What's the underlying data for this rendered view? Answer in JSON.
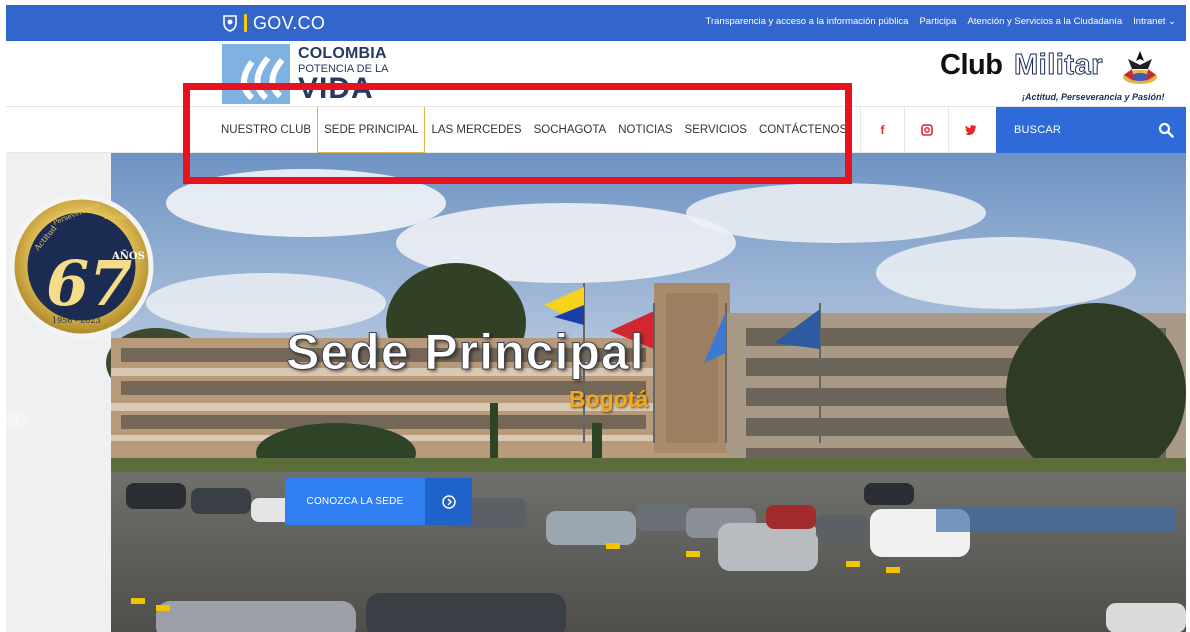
{
  "gov_bar": {
    "logo_text": "GOV.CO",
    "links": [
      "Transparencia y acceso a la información pública",
      "Participa",
      "Atención y Servicios a la Ciudadanía",
      "Intranet ⌄"
    ],
    "color": "#3366cc"
  },
  "header": {
    "colombia_logo": {
      "line1": "COLOMBIA",
      "line2": "POTENCIA DE LA",
      "line3": "VIDA"
    },
    "club_logo": {
      "club": "Club",
      "militar": "Militar",
      "tagline": "¡Actitud, Perseverancia y Pasión!"
    }
  },
  "nav": {
    "items": [
      "NUESTRO CLUB",
      "SEDE PRINCIPAL",
      "LAS MERCEDES",
      "SOCHAGOTA",
      "NOTICIAS",
      "SERVICIOS",
      "CONTÁCTENOS"
    ],
    "active": "SEDE PRINCIPAL",
    "social": [
      {
        "name": "facebook-icon",
        "glyph": "f"
      },
      {
        "name": "instagram-icon",
        "glyph": "◙"
      },
      {
        "name": "twitter-icon",
        "glyph": "🐦"
      }
    ],
    "search_label": "BUSCAR",
    "search_color": "#2f6bd8"
  },
  "hero": {
    "title": "Sede Principal",
    "subtitle": "Bogotá",
    "cta_label": "CONOZCA LA SEDE",
    "cta_color": "#2f7ff0",
    "subtitle_color": "#f4a81c"
  },
  "badge": {
    "number": "67",
    "years": "AÑOS",
    "words": "Actitud Perseverancia Pasión",
    "range": "1956 - 2023"
  },
  "annotation": {
    "color": "#e8121e"
  }
}
